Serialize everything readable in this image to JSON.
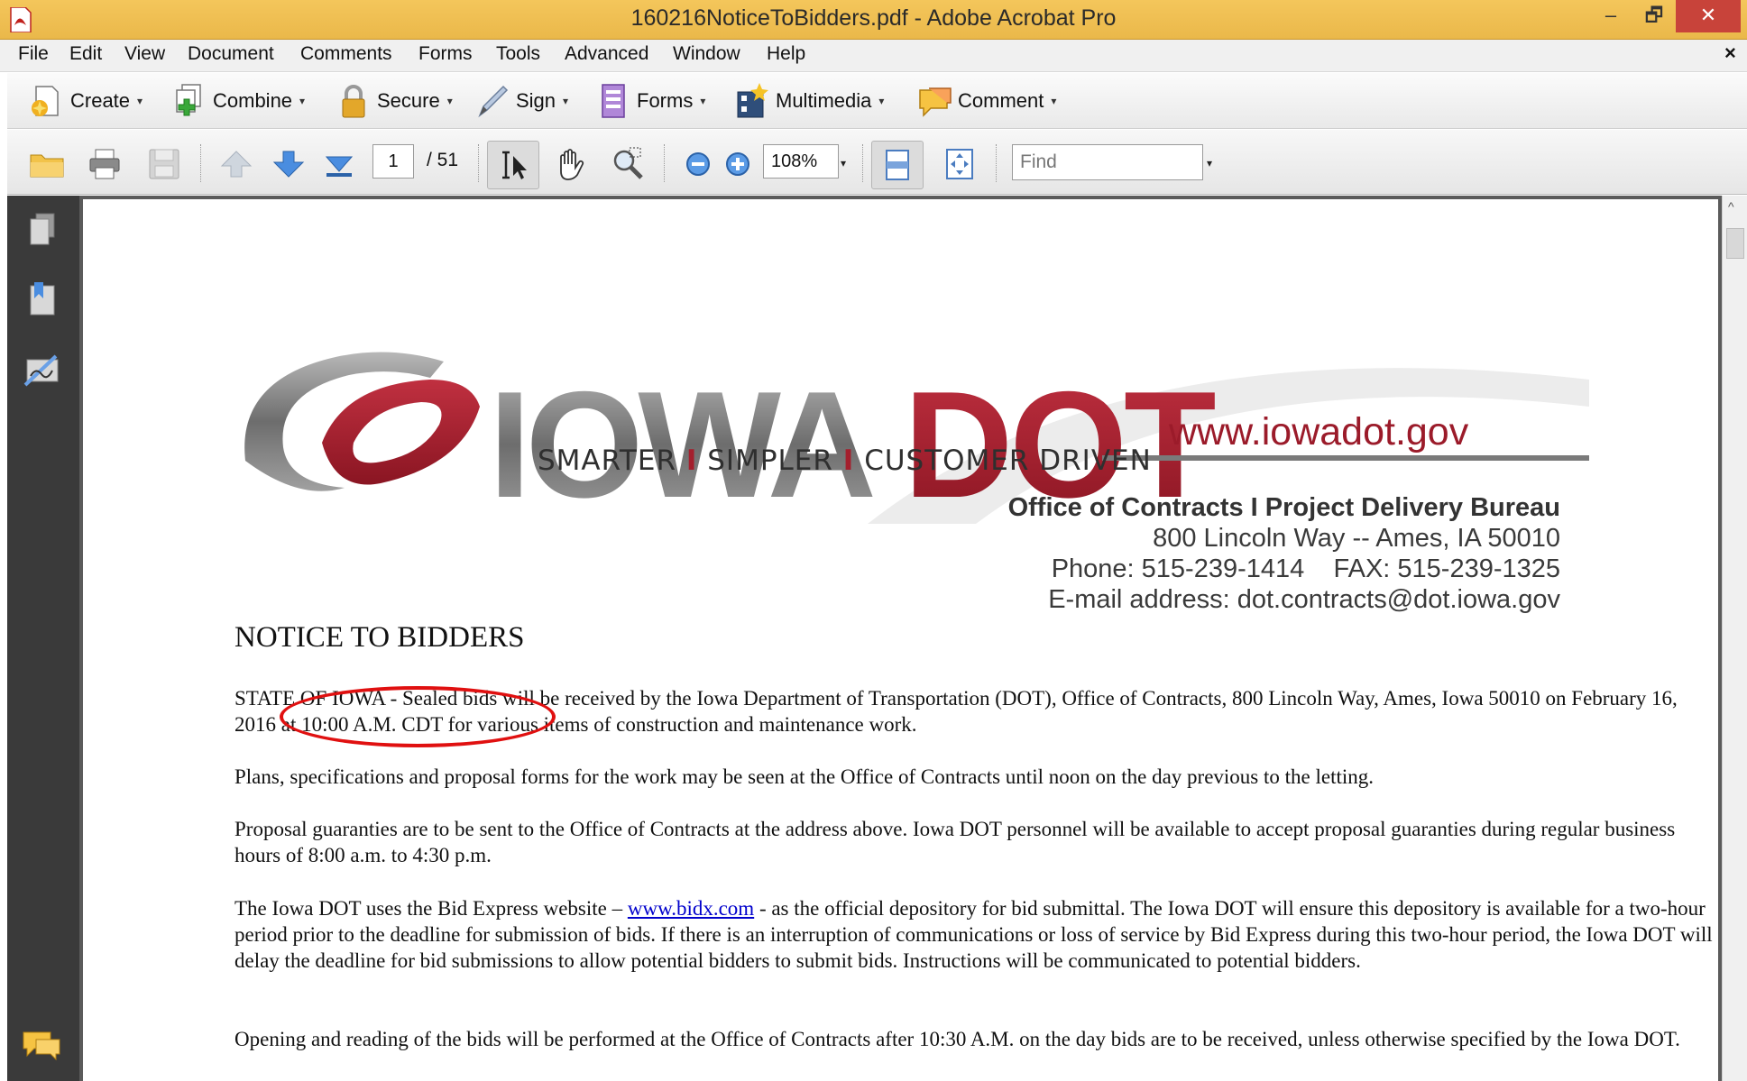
{
  "window": {
    "title": "160216NoticeToBidders.pdf - Adobe Acrobat Pro",
    "minimize": "–",
    "restore": "🗗",
    "close": "✕"
  },
  "menu": {
    "items": [
      "File",
      "Edit",
      "View",
      "Document",
      "Comments",
      "Forms",
      "Tools",
      "Advanced",
      "Window",
      "Help"
    ],
    "close_doc": "×"
  },
  "tasks": {
    "create": "Create",
    "combine": "Combine",
    "secure": "Secure",
    "sign": "Sign",
    "forms": "Forms",
    "multimedia": "Multimedia",
    "comment": "Comment",
    "dropdown_glyph": "▾"
  },
  "toolbar": {
    "current_page": "1",
    "total_pages": "/ 51",
    "zoom": "108%",
    "find_placeholder": "Find",
    "dropdown_glyph": "▾"
  },
  "document": {
    "logo_text_iowa": "IOWA",
    "logo_text_dot": "DOT",
    "website": "www.iowadot.gov",
    "tagline_1": "SMARTER",
    "tagline_2": "SIMPLER",
    "tagline_3": "CUSTOMER DRIVEN",
    "tagline_sep": "I",
    "office_lines": [
      "Office of Contracts I Project Delivery Bureau",
      "800 Lincoln Way -- Ames, IA 50010",
      "Phone: 515-239-1414    FAX: 515-239-1325",
      "E-mail address: dot.contracts@dot.iowa.gov"
    ],
    "notice_title": "NOTICE TO BIDDERS",
    "para1": "STATE OF IOWA - Sealed bids will be received by the Iowa Department of Transportation (DOT), Office of Contracts, 800 Lincoln Way, Ames, Iowa 50010 on February 16, 2016 at 10:00 A.M. CDT for various items of construction and maintenance work.",
    "para2": "Plans, specifications and proposal forms for the work may be seen at the Office of Contracts until noon on the day previous to the letting.",
    "para3": "Proposal guaranties are to be sent to the Office of Contracts at the address above. Iowa DOT personnel will be available to accept proposal guaranties during regular business hours of 8:00 a.m. to 4:30 p.m.",
    "para4_before": "The Iowa DOT uses the Bid Express website – ",
    "para4_link": "www.bidx.com",
    "para4_after": " - as the official depository for bid submittal. The Iowa DOT will ensure this depository is available for a two-hour period prior to the deadline for submission of bids. If there is an interruption of communications or loss of service by Bid Express during this two-hour period, the Iowa DOT will delay the deadline for bid submissions to allow potential bidders to submit bids. Instructions will be communicated to potential bidders.",
    "para5": "Opening and reading of the bids will be performed at the Office of Contracts after 10:30 A.M. on the day bids are to be received, unless otherwise specified by the Iowa DOT."
  },
  "colors": {
    "titlebar": "#eab84a",
    "dot_red": "#a41f2d",
    "annotation_red": "#e01010",
    "link_blue": "#0000cc"
  }
}
